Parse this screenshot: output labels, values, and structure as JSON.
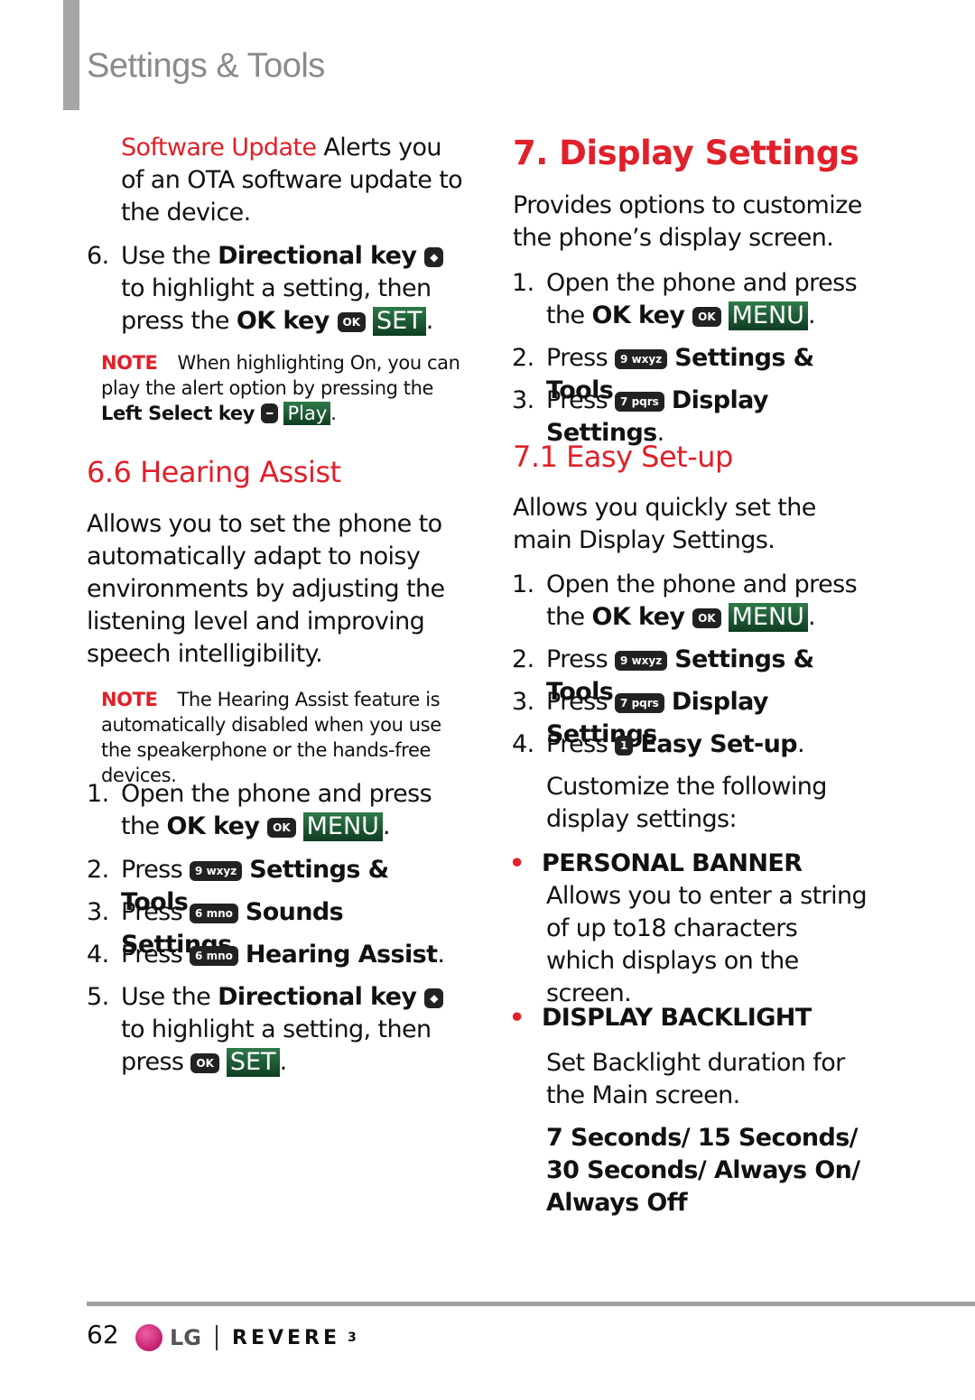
{
  "header": {
    "title": "Settings & Tools"
  },
  "blocks": {
    "sw": [
      [
        "r",
        "Software Update"
      ],
      [
        "t",
        "  Alerts you of an OTA software update to the device."
      ]
    ],
    "s6": {
      "n": "6.",
      "segs": [
        [
          "t",
          "Use the "
        ],
        [
          "b",
          "Directional key "
        ],
        [
          "k",
          "◆"
        ],
        [
          "t",
          " to highlight a setting, then press the "
        ],
        [
          "b",
          "OK key "
        ],
        [
          "k",
          "OK"
        ],
        [
          "t",
          " "
        ],
        [
          "s",
          "SET"
        ],
        [
          "t",
          "."
        ]
      ]
    },
    "note1": [
      [
        "n",
        "NOTE"
      ],
      [
        "t",
        "When highlighting On, you can play the alert option by pressing the "
      ],
      [
        "b",
        "Left Select key "
      ],
      [
        "k",
        "━"
      ],
      [
        "t",
        " "
      ],
      [
        "s",
        "Play"
      ],
      [
        "t",
        "."
      ]
    ],
    "h66": [
      [
        "t",
        "6.6 Hearing Assist"
      ]
    ],
    "p66": [
      [
        "t",
        "Allows you to set the phone to automatically adapt to noisy environments by adjusting the listening level and improving speech intelligibility."
      ]
    ],
    "note2": [
      [
        "n",
        "NOTE"
      ],
      [
        "t",
        "The Hearing Assist feature is automatically disabled when you use the speakerphone or the hands-free devices."
      ]
    ],
    "l1": {
      "n": "1.",
      "segs": [
        [
          "t",
          "Open the phone and press the "
        ],
        [
          "b",
          "OK key "
        ],
        [
          "k",
          "OK"
        ],
        [
          "t",
          " "
        ],
        [
          "s",
          "MENU"
        ],
        [
          "t",
          "."
        ]
      ]
    },
    "l2": {
      "n": "2.",
      "segs": [
        [
          "t",
          "Press "
        ],
        [
          "k",
          "9 wxyz"
        ],
        [
          "t",
          " "
        ],
        [
          "b",
          "Settings & Tools"
        ],
        [
          "t",
          "."
        ]
      ]
    },
    "l3": {
      "n": "3.",
      "segs": [
        [
          "t",
          "Press "
        ],
        [
          "k",
          "6 mno"
        ],
        [
          "t",
          " "
        ],
        [
          "b",
          "Sounds Settings"
        ],
        [
          "t",
          "."
        ]
      ]
    },
    "l4": {
      "n": "4.",
      "segs": [
        [
          "t",
          "Press "
        ],
        [
          "k",
          "6 mno"
        ],
        [
          "t",
          " "
        ],
        [
          "b",
          "Hearing Assist"
        ],
        [
          "t",
          "."
        ]
      ]
    },
    "l5": {
      "n": "5.",
      "segs": [
        [
          "t",
          "Use the "
        ],
        [
          "b",
          "Directional key "
        ],
        [
          "k",
          "◆"
        ],
        [
          "t",
          " to highlight a setting, then press "
        ],
        [
          "k",
          "OK"
        ],
        [
          "t",
          " "
        ],
        [
          "s",
          "SET"
        ],
        [
          "t",
          "."
        ]
      ]
    },
    "h7": [
      [
        "t",
        "7. Display Settings"
      ]
    ],
    "p7": [
      [
        "t",
        "Provides options to customize the phone’s display screen."
      ]
    ],
    "r1": {
      "n": "1.",
      "segs": [
        [
          "t",
          "Open the phone and press the "
        ],
        [
          "b",
          "OK key "
        ],
        [
          "k",
          "OK"
        ],
        [
          "t",
          " "
        ],
        [
          "s",
          "MENU"
        ],
        [
          "t",
          "."
        ]
      ]
    },
    "r2": {
      "n": "2.",
      "segs": [
        [
          "t",
          "Press "
        ],
        [
          "k",
          "9 wxyz"
        ],
        [
          "t",
          " "
        ],
        [
          "b",
          "Settings & Tools"
        ],
        [
          "t",
          "."
        ]
      ]
    },
    "r3": {
      "n": "3.",
      "segs": [
        [
          "t",
          "Press "
        ],
        [
          "k",
          "7 pqrs"
        ],
        [
          "t",
          " "
        ],
        [
          "b",
          "Display Settings"
        ],
        [
          "t",
          "."
        ]
      ]
    },
    "h71": [
      [
        "t",
        "7.1 Easy Set-up"
      ]
    ],
    "p71": [
      [
        "t",
        "Allows you quickly set the main Display Settings."
      ]
    ],
    "q1": {
      "n": "1.",
      "segs": [
        [
          "t",
          "Open the phone and press the "
        ],
        [
          "b",
          "OK key "
        ],
        [
          "k",
          "OK"
        ],
        [
          "t",
          " "
        ],
        [
          "s",
          "MENU"
        ],
        [
          "t",
          "."
        ]
      ]
    },
    "q2": {
      "n": "2.",
      "segs": [
        [
          "t",
          "Press "
        ],
        [
          "k",
          "9 wxyz"
        ],
        [
          "t",
          " "
        ],
        [
          "b",
          "Settings & Tools"
        ],
        [
          "t",
          "."
        ]
      ]
    },
    "q3": {
      "n": "3.",
      "segs": [
        [
          "t",
          "Press "
        ],
        [
          "k",
          "7 pqrs"
        ],
        [
          "t",
          " "
        ],
        [
          "b",
          "Display Settings"
        ],
        [
          "t",
          "."
        ]
      ]
    },
    "q4": {
      "n": "4.",
      "segs": [
        [
          "t",
          "Press "
        ],
        [
          "k",
          "1"
        ],
        [
          "t",
          " "
        ],
        [
          "b",
          "Easy Set-up"
        ],
        [
          "t",
          "."
        ]
      ]
    },
    "cust": [
      [
        "t",
        "Customize the following display settings:"
      ]
    ],
    "b1": {
      "bullet": "•",
      "segs": [
        [
          "t",
          "PERSONAL BANNER"
        ]
      ]
    },
    "pb1": [
      [
        "t",
        "Allows you to enter a string of up to18 characters which displays on the screen."
      ]
    ],
    "b2": {
      "bullet": "•",
      "segs": [
        [
          "t",
          "DISPLAY BACKLIGHT"
        ]
      ]
    },
    "pb2": [
      [
        "t",
        "Set Backlight duration for the Main screen."
      ]
    ],
    "opts": [
      [
        "b",
        "7 Seconds/ 15 Seconds/ 30 Seconds/ Always On/ Always Off"
      ]
    ]
  },
  "footer": {
    "page_number": "62",
    "brand": "LG",
    "model": "REVERE",
    "model_suffix": "3"
  }
}
